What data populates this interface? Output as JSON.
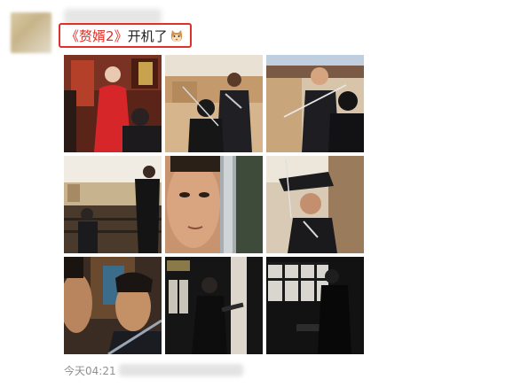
{
  "post": {
    "caption_open": "《",
    "caption_title": "赘婿2",
    "caption_close": "》",
    "caption_text": "开机了",
    "emoji_icon": "cat-face-icon",
    "timestamp": "今天04:21",
    "accent_color": "#e0302a",
    "photos": [
      {
        "id": "photo-1",
        "subject": "woman in red dress facing figure in black"
      },
      {
        "id": "photo-2",
        "subject": "swordsmen on earthen terrace"
      },
      {
        "id": "photo-3",
        "subject": "bald actor with sword, boy in foreground"
      },
      {
        "id": "photo-4",
        "subject": "figure in black on balcony over courtyard"
      },
      {
        "id": "photo-5",
        "subject": "close-up of face beside sword blade"
      },
      {
        "id": "photo-6",
        "subject": "man holding raised sword"
      },
      {
        "id": "photo-7",
        "subject": "two faces in profile, close-up"
      },
      {
        "id": "photo-8",
        "subject": "silhouette near window in dark hall"
      },
      {
        "id": "photo-9",
        "subject": "figure at table by lattice window"
      }
    ]
  }
}
